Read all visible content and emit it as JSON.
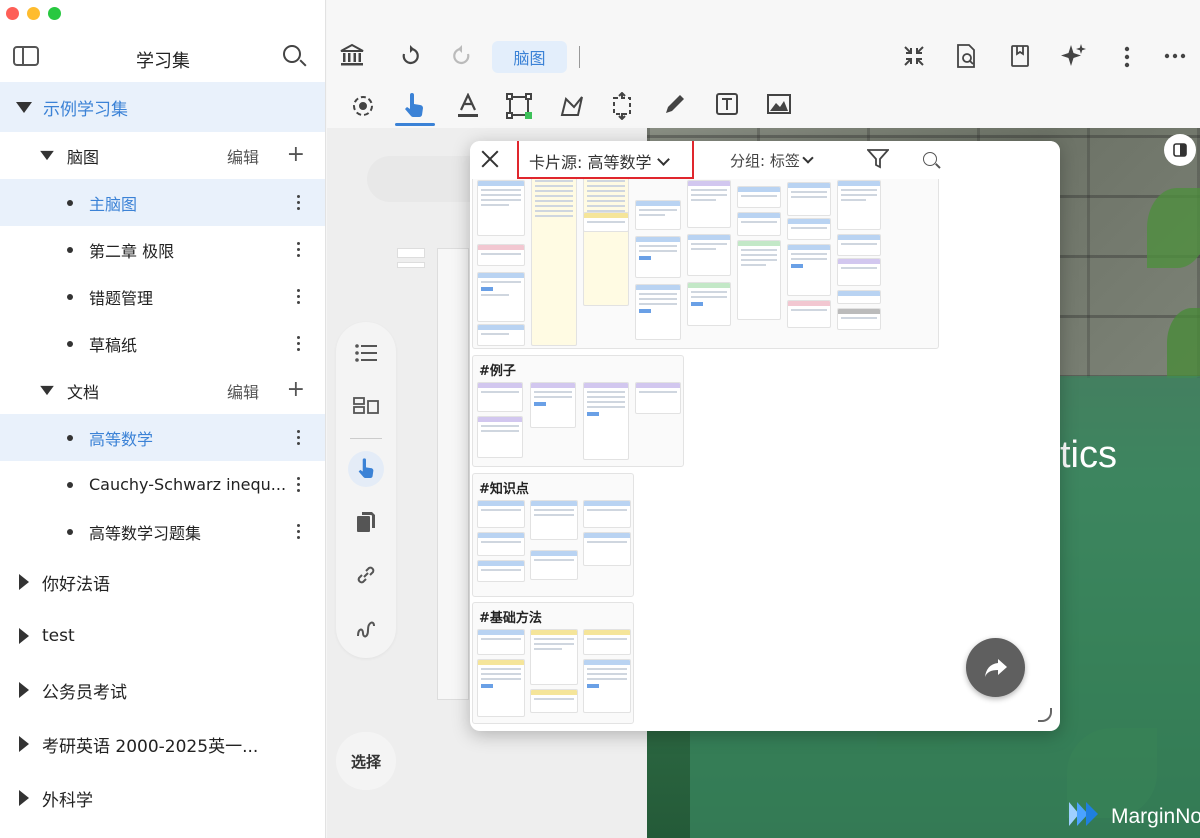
{
  "sidebar": {
    "title": "学习集",
    "root": {
      "label": "示例学习集"
    },
    "sections": [
      {
        "label": "脑图",
        "edit": "编辑",
        "items": [
          "主脑图",
          "第二章 极限",
          "错题管理",
          "草稿纸"
        ]
      },
      {
        "label": "文档",
        "edit": "编辑",
        "items": [
          "高等数学",
          "Cauchy-Schwarz inequ...",
          "高等数学习题集"
        ]
      }
    ],
    "collections": [
      "你好法语",
      "test",
      "公务员考试",
      "考研英语 2000-2025英一...",
      "外科学"
    ]
  },
  "toolbar": {
    "mode_button": "脑图",
    "icons": [
      "library-icon",
      "undo-icon",
      "redo-icon",
      "collapse-icon",
      "document-search-icon",
      "bookmark-icon",
      "sparkle-icon",
      "more-vertical-icon",
      "more-horizontal-icon"
    ],
    "tools": [
      "lasso-rotate-icon",
      "pointer-icon",
      "text-format-icon",
      "rectangle-select-icon",
      "shape-icon",
      "transform-icon",
      "pencil-icon",
      "textbox-icon",
      "image-icon"
    ]
  },
  "side_panel": {
    "icons": [
      "list-icon",
      "layout-icon",
      "pointer-icon",
      "copy-icon",
      "link-icon",
      "squiggle-icon"
    ],
    "select_label": "选择"
  },
  "popup": {
    "source_label": "卡片源: 高等数学",
    "group_label": "分组: 标签",
    "groups": [
      {
        "title": "#例子"
      },
      {
        "title": "#知识点"
      },
      {
        "title": "#基础方法"
      }
    ]
  },
  "background": {
    "partial_title": "tics",
    "brand": "MarginNote"
  },
  "colors": {
    "accent": "#3b82d6",
    "highlight_border": "#e0262d",
    "selected_row": "#e9f1fb"
  }
}
